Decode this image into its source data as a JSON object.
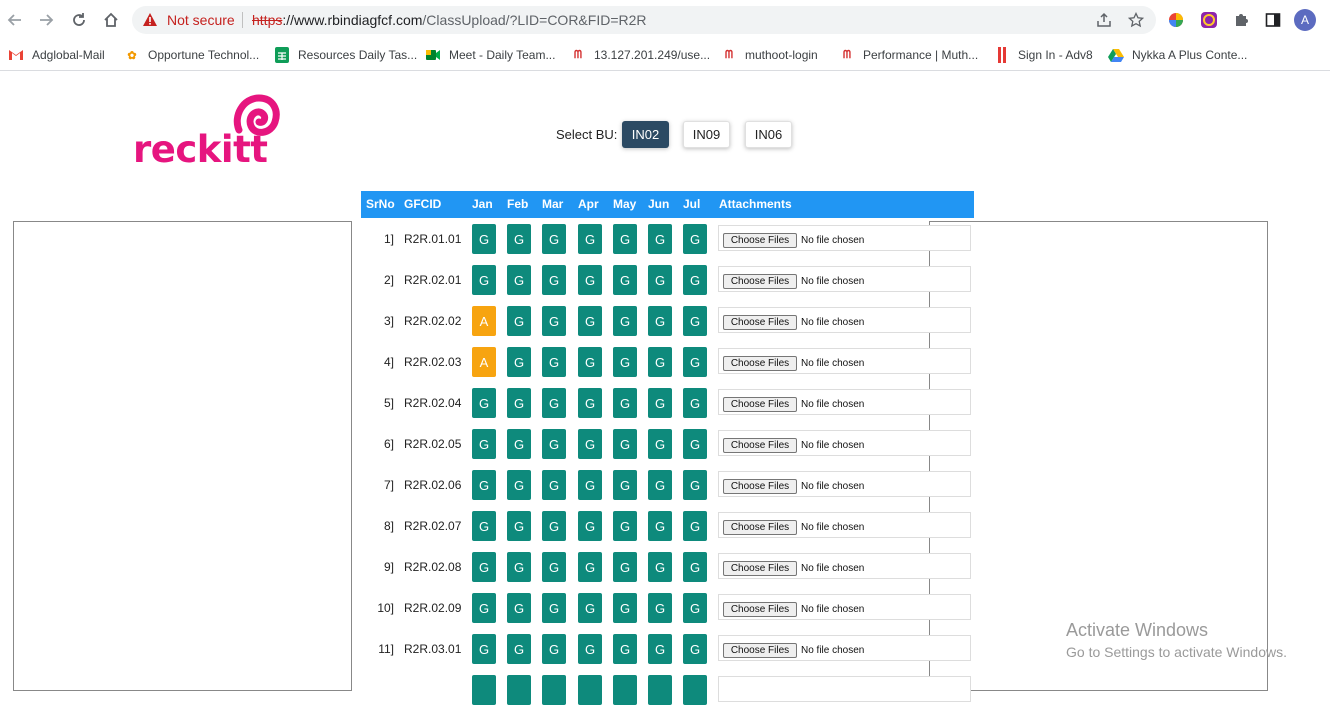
{
  "browser": {
    "security_label": "Not secure",
    "url_protocol": "https",
    "url_host": "://www.rbindiagfcf.com",
    "url_path": "/ClassUpload/?LID=COR&FID=R2R",
    "profile_initial": "A",
    "bookmarks": [
      {
        "label": "Adglobal-Mail",
        "icon": "gmail-icon"
      },
      {
        "label": "Opportune Technol...",
        "icon": "opportune-icon"
      },
      {
        "label": "Resources Daily Tas...",
        "icon": "sheets-icon"
      },
      {
        "label": "Meet - Daily Team...",
        "icon": "meet-icon"
      },
      {
        "label": "13.127.201.249/use...",
        "icon": "muthoot-icon"
      },
      {
        "label": "muthoot-login",
        "icon": "muthoot-icon"
      },
      {
        "label": "Performance | Muth...",
        "icon": "muthoot-icon"
      },
      {
        "label": "Sign In - Adv8",
        "icon": "adv8-icon"
      },
      {
        "label": "Nykka A Plus Conte...",
        "icon": "drive-icon"
      }
    ]
  },
  "brand": {
    "logo_text": "reckitt",
    "color": "#e6157f"
  },
  "bu": {
    "label": "Select BU:",
    "options": [
      "IN02",
      "IN09",
      "IN06"
    ],
    "selected": "IN02"
  },
  "table": {
    "headers": [
      "SrNo",
      "GFCID",
      "Jan",
      "Feb",
      "Mar",
      "Apr",
      "May",
      "Jun",
      "Jul",
      "Attachments"
    ],
    "choose_label": "Choose Files",
    "no_file_label": "No file chosen",
    "rows": [
      {
        "srno": "1]",
        "gfcid": "R2R.01.01",
        "status": [
          "G",
          "G",
          "G",
          "G",
          "G",
          "G",
          "G"
        ]
      },
      {
        "srno": "2]",
        "gfcid": "R2R.02.01",
        "status": [
          "G",
          "G",
          "G",
          "G",
          "G",
          "G",
          "G"
        ]
      },
      {
        "srno": "3]",
        "gfcid": "R2R.02.02",
        "status": [
          "A",
          "G",
          "G",
          "G",
          "G",
          "G",
          "G"
        ]
      },
      {
        "srno": "4]",
        "gfcid": "R2R.02.03",
        "status": [
          "A",
          "G",
          "G",
          "G",
          "G",
          "G",
          "G"
        ]
      },
      {
        "srno": "5]",
        "gfcid": "R2R.02.04",
        "status": [
          "G",
          "G",
          "G",
          "G",
          "G",
          "G",
          "G"
        ]
      },
      {
        "srno": "6]",
        "gfcid": "R2R.02.05",
        "status": [
          "G",
          "G",
          "G",
          "G",
          "G",
          "G",
          "G"
        ]
      },
      {
        "srno": "7]",
        "gfcid": "R2R.02.06",
        "status": [
          "G",
          "G",
          "G",
          "G",
          "G",
          "G",
          "G"
        ]
      },
      {
        "srno": "8]",
        "gfcid": "R2R.02.07",
        "status": [
          "G",
          "G",
          "G",
          "G",
          "G",
          "G",
          "G"
        ]
      },
      {
        "srno": "9]",
        "gfcid": "R2R.02.08",
        "status": [
          "G",
          "G",
          "G",
          "G",
          "G",
          "G",
          "G"
        ]
      },
      {
        "srno": "10]",
        "gfcid": "R2R.02.09",
        "status": [
          "G",
          "G",
          "G",
          "G",
          "G",
          "G",
          "G"
        ]
      },
      {
        "srno": "11]",
        "gfcid": "R2R.03.01",
        "status": [
          "G",
          "G",
          "G",
          "G",
          "G",
          "G",
          "G"
        ]
      }
    ],
    "status_colors": {
      "G": "#0e8a7c",
      "A": "#f7a410"
    }
  },
  "watermark": {
    "title": "Activate Windows",
    "subtitle": "Go to Settings to activate Windows."
  }
}
